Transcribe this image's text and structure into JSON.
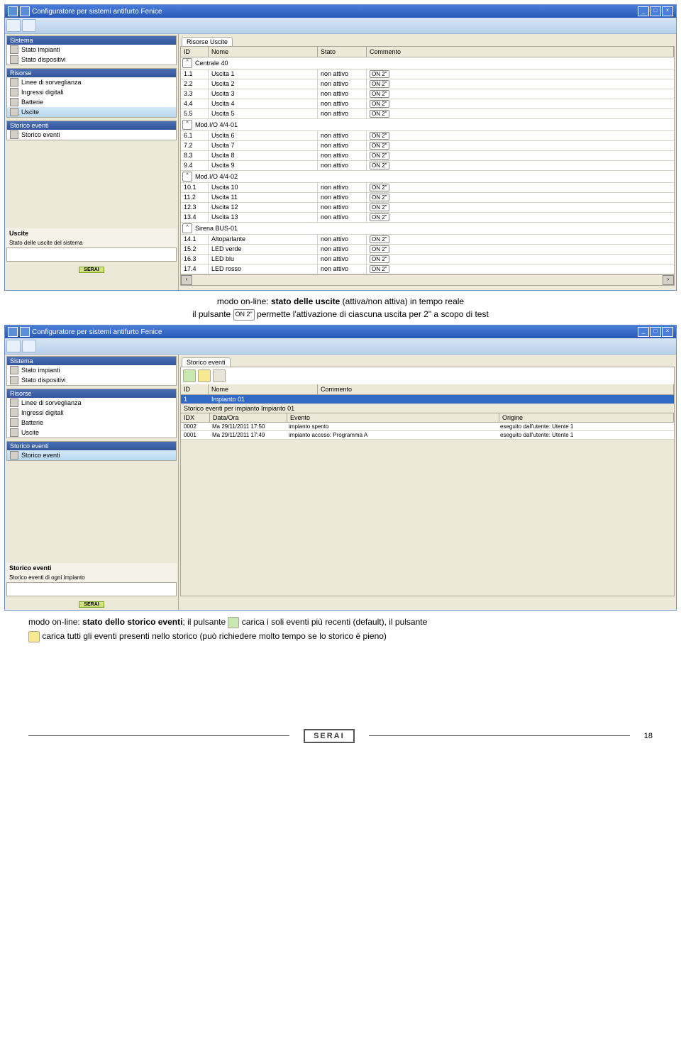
{
  "window_title": "Configuratore per sistemi antifurto Fenice",
  "sidebar": {
    "groups": [
      {
        "title": "Sistema",
        "items": [
          "Stato impianti",
          "Stato dispositivi"
        ]
      },
      {
        "title": "Risorse",
        "items": [
          "Linee di sorveglianza",
          "Ingressi digitali",
          "Batterie",
          "Uscite"
        ]
      },
      {
        "title": "Storico eventi",
        "items": [
          "Storico eventi"
        ]
      }
    ],
    "device1": {
      "name": "Uscite",
      "sub": "Stato delle uscite del sistema"
    },
    "device2": {
      "name": "Storico eventi",
      "sub": "Storico eventi di ogni impianto"
    }
  },
  "uscite_tab": "Risorse Uscite",
  "uscite_cols": {
    "id": "ID",
    "nome": "Nome",
    "stato": "Stato",
    "commento": "Commento"
  },
  "on_label": "ON 2\"",
  "uscite_groups": [
    {
      "name": "Centrale 40",
      "rows": [
        {
          "id": "1.1",
          "nome": "Uscita 1",
          "stato": "non attivo"
        },
        {
          "id": "2.2",
          "nome": "Uscita 2",
          "stato": "non attivo"
        },
        {
          "id": "3.3",
          "nome": "Uscita 3",
          "stato": "non attivo"
        },
        {
          "id": "4.4",
          "nome": "Uscita 4",
          "stato": "non attivo"
        },
        {
          "id": "5.5",
          "nome": "Uscita 5",
          "stato": "non attivo"
        }
      ]
    },
    {
      "name": "Mod.I/O 4/4-01",
      "rows": [
        {
          "id": "6.1",
          "nome": "Uscita 6",
          "stato": "non attivo"
        },
        {
          "id": "7.2",
          "nome": "Uscita 7",
          "stato": "non attivo"
        },
        {
          "id": "8.3",
          "nome": "Uscita 8",
          "stato": "non attivo"
        },
        {
          "id": "9.4",
          "nome": "Uscita 9",
          "stato": "non attivo"
        }
      ]
    },
    {
      "name": "Mod.I/O 4/4-02",
      "rows": [
        {
          "id": "10.1",
          "nome": "Uscita 10",
          "stato": "non attivo"
        },
        {
          "id": "11.2",
          "nome": "Uscita 11",
          "stato": "non attivo"
        },
        {
          "id": "12.3",
          "nome": "Uscita 12",
          "stato": "non attivo"
        },
        {
          "id": "13.4",
          "nome": "Uscita 13",
          "stato": "non attivo"
        }
      ]
    },
    {
      "name": "Sirena BUS-01",
      "rows": [
        {
          "id": "14.1",
          "nome": "Altoparlante",
          "stato": "non attivo"
        },
        {
          "id": "15.2",
          "nome": "LED verde",
          "stato": "non attivo"
        },
        {
          "id": "16.3",
          "nome": "LED blu",
          "stato": "non attivo"
        },
        {
          "id": "17.4",
          "nome": "LED rosso",
          "stato": "non attivo"
        }
      ]
    }
  ],
  "caption1": {
    "a": "modo on-line: ",
    "b": "stato delle uscite",
    "c": " (attiva/non attiva) in tempo reale",
    "d": "il pulsante ",
    "e": " permette l'attivazione di ciascuna uscita per 2\" a scopo di test"
  },
  "storico_tab": "Storico eventi",
  "storico_cols": {
    "id": "ID",
    "nome": "Nome",
    "commento": "Commento"
  },
  "storico_row": {
    "id": "1",
    "nome": "Impianto 01"
  },
  "storico_sub": "Storico eventi per impianto Impianto 01",
  "ev_cols": {
    "idx": "IDX",
    "data": "Data/Ora",
    "ev": "Evento",
    "or": "Origine"
  },
  "events": [
    {
      "idx": "0002",
      "data": "Ma 29/11/2011 17:50",
      "ev": "impianto spento",
      "or": "eseguito dall'utente: Utente 1"
    },
    {
      "idx": "0001",
      "data": "Ma 29/11/2011 17:49",
      "ev": "impianto acceso: Programma A",
      "or": "eseguito dall'utente: Utente 1"
    }
  ],
  "caption2": {
    "a": "modo on-line: ",
    "b": "stato dello storico eventi",
    "c": "; il pulsante ",
    "d": " carica i soli eventi più recenti (default), il pulsante",
    "e": " carica tutti gli eventi presenti nello storico (può richiedere molto tempo se lo storico è pieno)"
  },
  "brand": "SERAI",
  "footer_brand": "SERAI",
  "pagenum": "18"
}
